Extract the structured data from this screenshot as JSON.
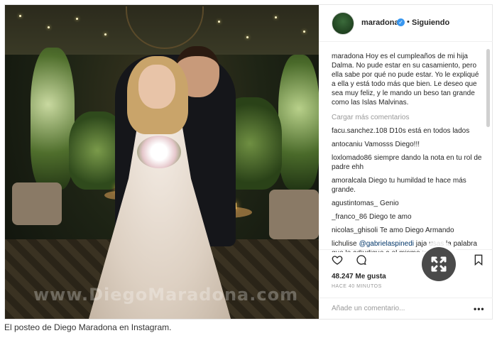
{
  "post": {
    "username": "maradona",
    "follow_status": "Siguiendo",
    "caption_user": "maradona",
    "caption_text": "Hoy es el cumpleaños de mi hija Dalma. No pude estar en su casamiento, pero ella sabe por qué no pude estar. Yo le expliqué a ella y está todo más que bien. Le deseo que sea muy feliz, y le mando un beso tan grande como las Islas Malvinas.",
    "load_more": "Cargar más comentarios",
    "comments": [
      {
        "user": "facu.sanchez.108",
        "text": "D10s está en todos lados"
      },
      {
        "user": "antocaniu",
        "text": "Vamosss Diego!!!"
      },
      {
        "user": "loxlomado86",
        "text": "siempre dando la nota en tu rol de padre ehh"
      },
      {
        "user": "amoralcala",
        "text": "Diego tu humildad te hace más grande."
      },
      {
        "user": "agustintomas_",
        "text": "Genio"
      },
      {
        "user": "_franco_86",
        "text": "Diego te amo"
      },
      {
        "user": "nicolas_ghisoli",
        "text": "Te amo Diego Armando"
      },
      {
        "user": "lichulise",
        "mention": "@gabrielaspinedi",
        "text": "jaja usas la palabra que le adjudique a el mismo  trende"
      }
    ],
    "likes": "48.247 Me gusta",
    "time": "HACE 40 MINUTOS",
    "add_comment_placeholder": "Añade un comentario...",
    "more_label": "•••",
    "watermark": "www.DiegoMaradona.com",
    "verified_glyph": "✓",
    "dot": "•"
  },
  "figure_caption": "El posteo de Diego Maradona en Instagram.",
  "colors": {
    "link": "#003569",
    "muted": "#999999",
    "verified": "#3897f0"
  },
  "icons": {
    "heart": "heart-icon",
    "comment": "comment-bubble-icon",
    "bookmark": "bookmark-icon",
    "expand": "expand-icon"
  }
}
